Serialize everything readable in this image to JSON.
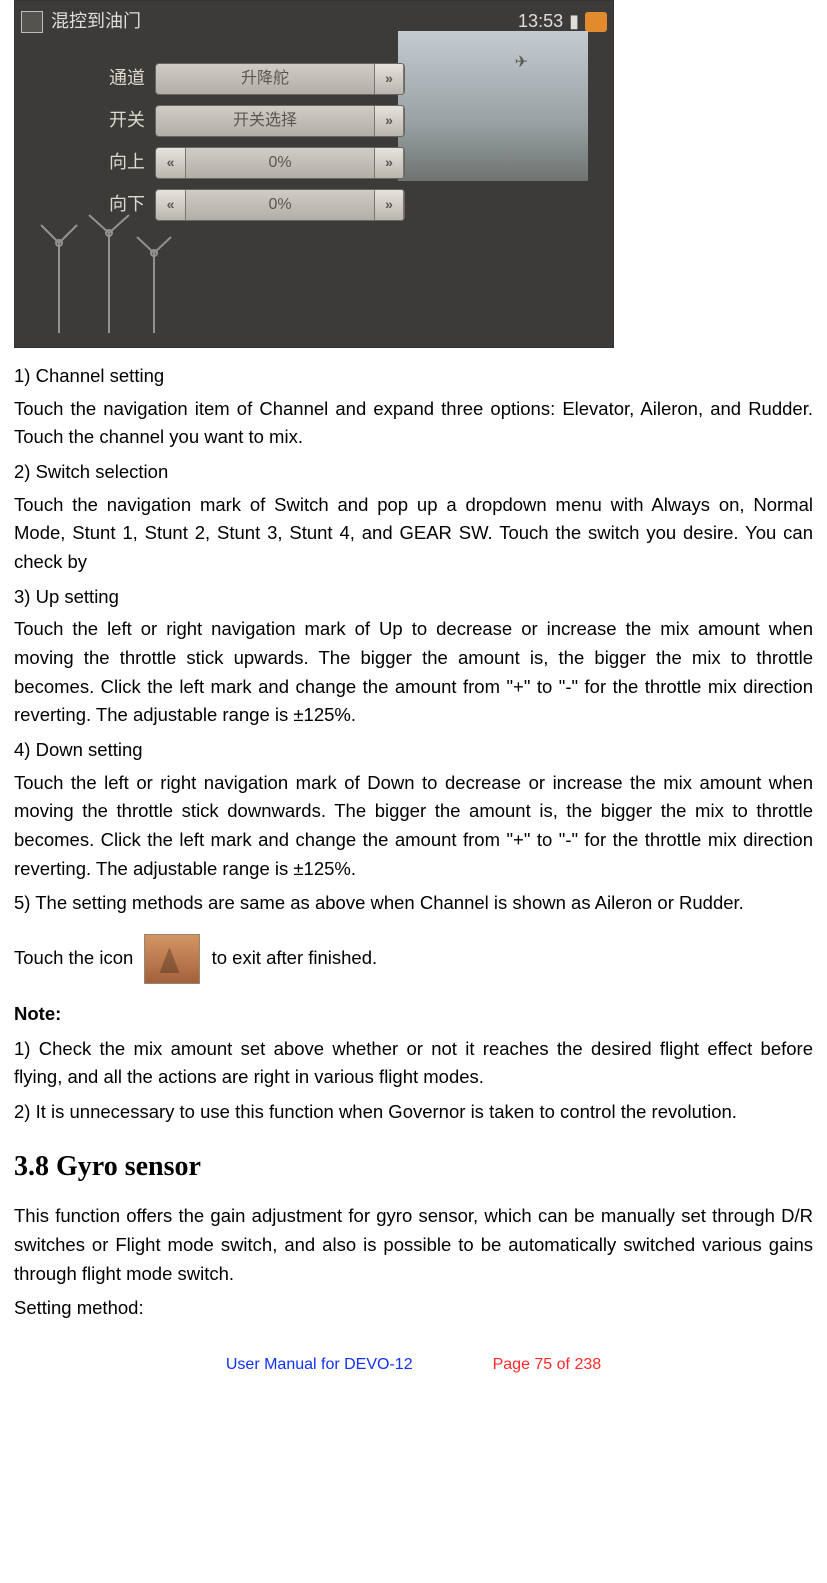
{
  "photo": {
    "title": "混控到油门",
    "time": "13:53",
    "rows": [
      {
        "label": "通道",
        "value": "升降舵",
        "leftNav": false,
        "rightNav": true
      },
      {
        "label": "开关",
        "value": "开关选择",
        "leftNav": false,
        "rightNav": true
      },
      {
        "label": "向上",
        "value": "0%",
        "leftNav": true,
        "rightNav": true
      },
      {
        "label": "向下",
        "value": "0%",
        "leftNav": true,
        "rightNav": true
      }
    ]
  },
  "sections": {
    "s1_title": "1)   Channel setting",
    "s1_body": "Touch the navigation item of Channel and expand three options: Elevator, Aileron, and Rudder. Touch the channel you want to mix.",
    "s2_title": "2)   Switch selection",
    "s2_body": "Touch the navigation mark of Switch and pop up a dropdown menu with Always on, Normal Mode, Stunt 1, Stunt 2, Stunt 3, Stunt 4, and GEAR SW. Touch the switch you desire. You can check by",
    "s3_title": "3)   Up setting",
    "s3_body": "Touch the left or right navigation mark of Up to decrease or increase the mix amount when moving the throttle stick upwards. The bigger the amount is, the bigger the mix to throttle becomes. Click the left mark and change the amount from \"+\" to \"-\" for the throttle mix direction reverting. The adjustable range is ±125%.",
    "s4_title": "4) Down setting",
    "s4_body": "Touch the left or right navigation mark of Down to decrease or increase the mix amount when moving the throttle stick downwards. The bigger the amount is, the bigger the mix to throttle becomes. Click the left mark and change the amount from \"+\" to \"-\" for the throttle mix direction reverting. The adjustable range is ±125%.",
    "s5_body": "5) The setting methods are same as above when Channel is shown as Aileron or Rudder.",
    "exit_prefix": "Touch the icon ",
    "exit_suffix": " to exit after finished.",
    "note_title": "Note:",
    "note1": "1) Check the mix amount set above whether or not it reaches the desired flight effect before flying, and all the actions are right in various flight modes.",
    "note2": "2) It is unnecessary to use this function when Governor is taken to control the revolution.",
    "h38": "3.8 Gyro sensor",
    "gyro_body": "This function offers the gain adjustment for gyro sensor, which can be manually set through D/R switches or Flight mode switch, and also is possible to be automatically switched various gains through flight mode switch.",
    "setting_method": "Setting method:"
  },
  "footer": {
    "left": "User Manual for DEVO-12",
    "right": "Page 75 of 238"
  }
}
